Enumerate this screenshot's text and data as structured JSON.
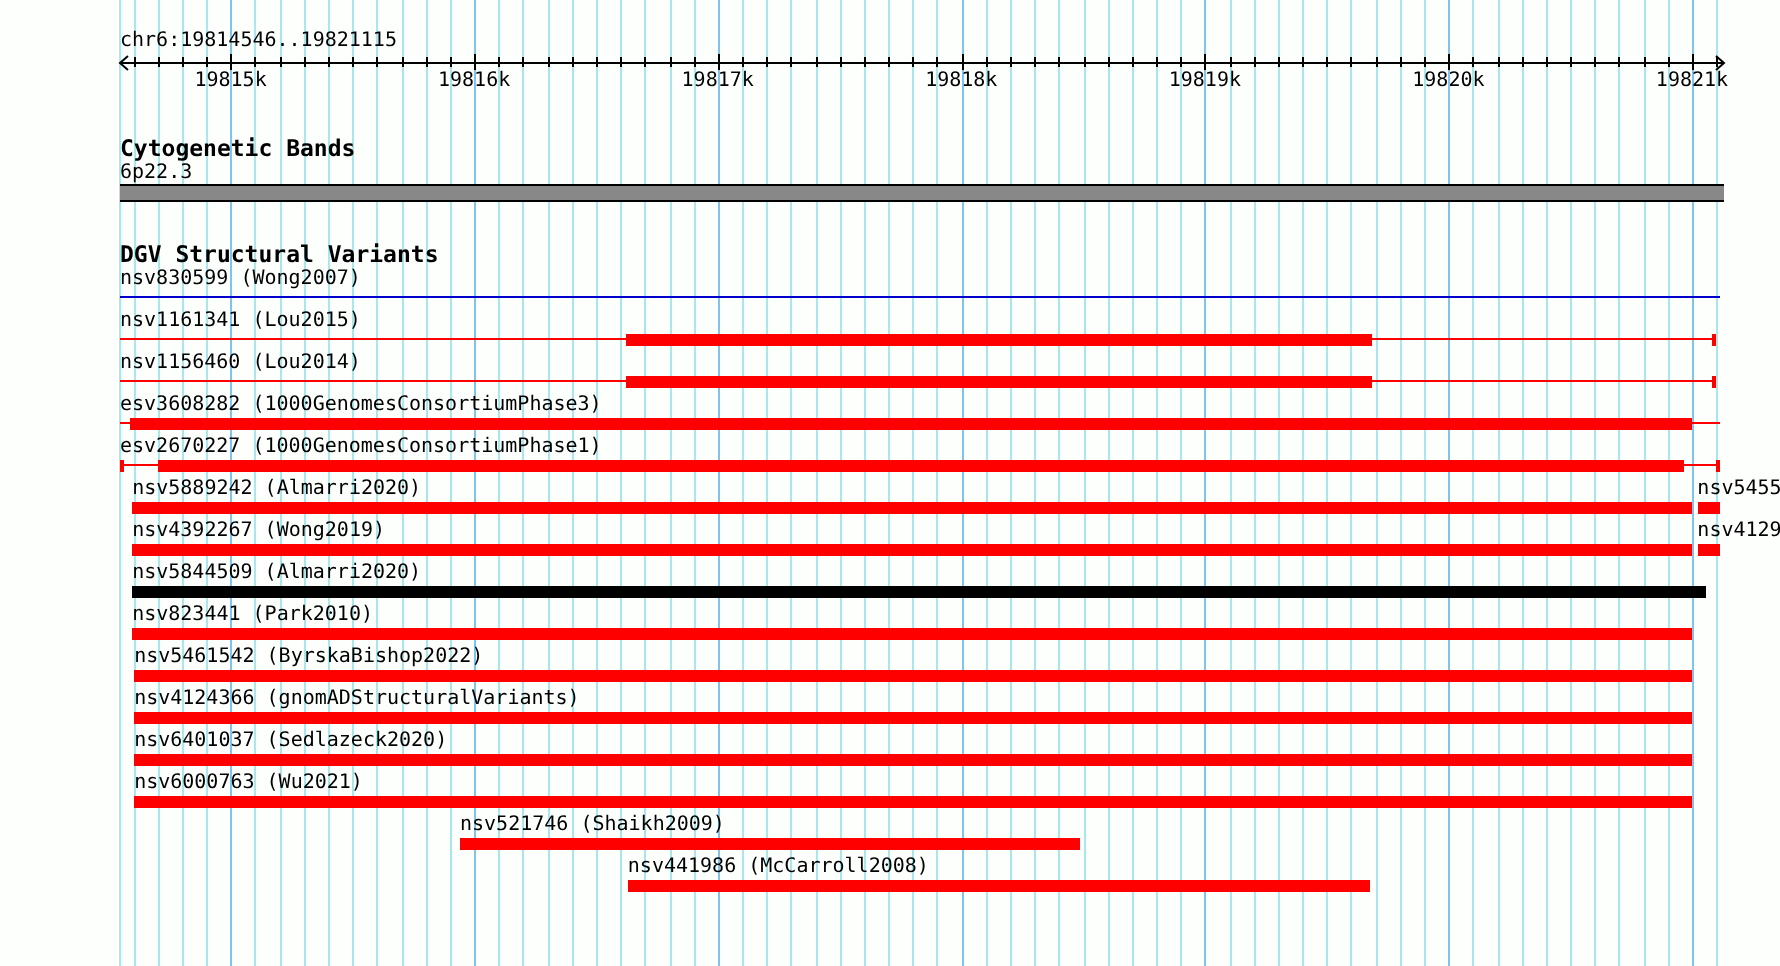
{
  "ruler": {
    "title": "chr6:19814546..19821115",
    "ticks": [
      "19815k",
      "19816k",
      "19817k",
      "19818k",
      "19819k",
      "19820k",
      "19821k"
    ]
  },
  "tracks": [
    {
      "kind": "band",
      "title": "Cytogenetic Bands",
      "band_label": "6p22.3",
      "color": "#888888"
    },
    {
      "kind": "variants",
      "title": "DGV Structural Variants",
      "rows": [
        {
          "features": [
            {
              "label": "nsv830599 (Wong2007)",
              "kind": "line",
              "cap_left": false,
              "cap_right": false,
              "color": "#0000cc"
            }
          ]
        },
        {
          "features": [
            {
              "label": "nsv1161341 (Lou2015)",
              "kind": "gapped",
              "cap_left": false,
              "cap_right": true,
              "color": "#ff0000"
            }
          ]
        },
        {
          "features": [
            {
              "label": "nsv1156460 (Lou2014)",
              "kind": "gapped",
              "cap_left": false,
              "cap_right": true,
              "color": "#ff0000"
            }
          ]
        },
        {
          "features": [
            {
              "label": "esv3608282 (1000GenomesConsortiumPhase3)",
              "kind": "gapped",
              "cap_left": false,
              "cap_right": false,
              "color": "#ff0000"
            }
          ]
        },
        {
          "features": [
            {
              "label": "esv2670227 (1000GenomesConsortiumPhase1)",
              "kind": "gapped",
              "cap_left": true,
              "cap_right": true,
              "color": "#ff0000"
            }
          ]
        },
        {
          "features": [
            {
              "label": "nsv5889242 (Almarri2020)",
              "kind": "thick",
              "color": "#ff0000"
            },
            {
              "label": "nsv5455",
              "kind": "thick",
              "color": "#ff0000"
            }
          ]
        },
        {
          "features": [
            {
              "label": "nsv4392267 (Wong2019)",
              "kind": "thick",
              "color": "#ff0000"
            },
            {
              "label": "nsv4129",
              "kind": "thick",
              "color": "#ff0000"
            }
          ]
        },
        {
          "features": [
            {
              "label": "nsv5844509 (Almarri2020)",
              "kind": "thick",
              "color": "#000000"
            }
          ]
        },
        {
          "features": [
            {
              "label": "nsv823441 (Park2010)",
              "kind": "thick",
              "color": "#ff0000"
            }
          ]
        },
        {
          "features": [
            {
              "label": "nsv5461542 (ByrskaBishop2022)",
              "kind": "thick",
              "color": "#ff0000"
            }
          ]
        },
        {
          "features": [
            {
              "label": "nsv4124366 (gnomADStructuralVariants)",
              "kind": "thick",
              "color": "#ff0000"
            }
          ]
        },
        {
          "features": [
            {
              "label": "nsv6401037 (Sedlazeck2020)",
              "kind": "thick",
              "color": "#ff0000"
            }
          ]
        },
        {
          "features": [
            {
              "label": "nsv6000763 (Wu2021)",
              "kind": "thick",
              "color": "#ff0000"
            }
          ]
        },
        {
          "features": [
            {
              "label": "nsv521746 (Shaikh2009)",
              "kind": "thick",
              "color": "#ff0000"
            }
          ]
        },
        {
          "features": [
            {
              "label": "nsv441986 (McCarroll2008)",
              "kind": "thick",
              "color": "#ff0000"
            }
          ]
        }
      ]
    }
  ]
}
